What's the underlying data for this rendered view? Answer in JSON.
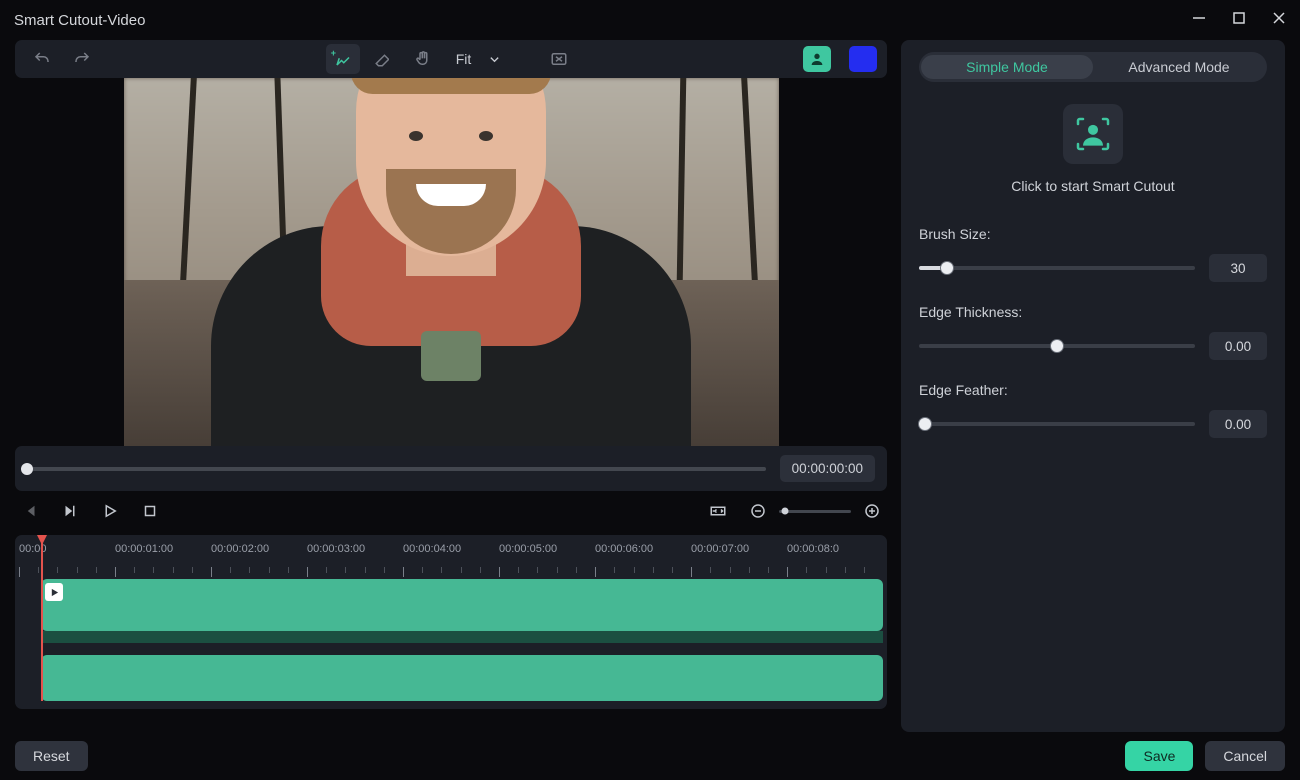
{
  "window": {
    "title": "Smart Cutout-Video"
  },
  "toolbar": {
    "zoom_label": "Fit"
  },
  "transport": {
    "time_display": "00:00:00:00"
  },
  "timeline": {
    "labels": [
      "00:00",
      "00:00:01:00",
      "00:00:02:00",
      "00:00:03:00",
      "00:00:04:00",
      "00:00:05:00",
      "00:00:06:00",
      "00:00:07:00",
      "00:00:08:0"
    ]
  },
  "panel": {
    "tabs": {
      "simple": "Simple Mode",
      "advanced": "Advanced Mode"
    },
    "cutout_caption": "Click to start Smart Cutout",
    "params": {
      "brush_label": "Brush Size:",
      "brush_value": "30",
      "brush_pct": 10,
      "edge_thickness_label": "Edge Thickness:",
      "edge_thickness_value": "0.00",
      "edge_thickness_pct": 50,
      "edge_feather_label": "Edge Feather:",
      "edge_feather_value": "0.00",
      "edge_feather_pct": 2
    }
  },
  "footer": {
    "reset": "Reset",
    "save": "Save",
    "cancel": "Cancel"
  }
}
